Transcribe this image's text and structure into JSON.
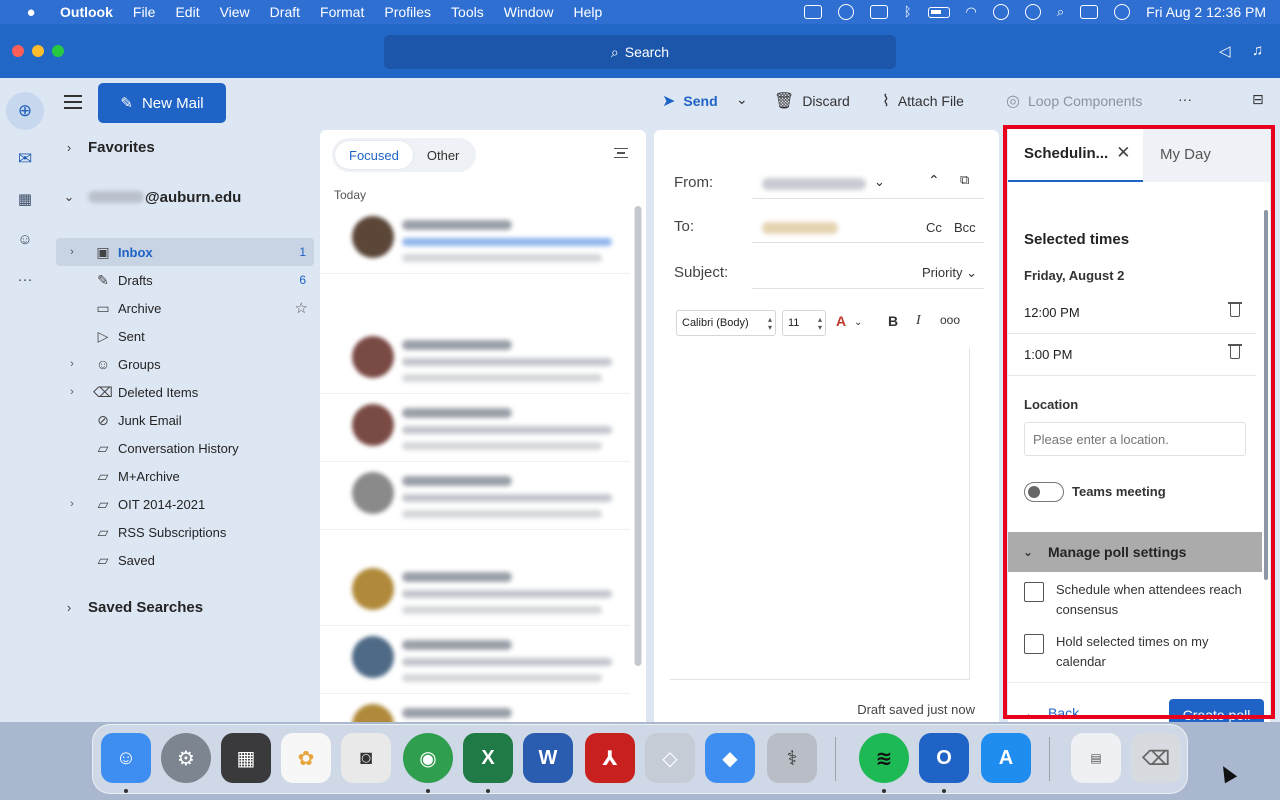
{
  "menubar": {
    "app_name": "Outlook",
    "items": [
      "File",
      "Edit",
      "View",
      "Draft",
      "Format",
      "Profiles",
      "Tools",
      "Window",
      "Help"
    ],
    "clock": "Fri Aug 2  12:36 PM"
  },
  "search": {
    "placeholder": "Search"
  },
  "toolbar": {
    "new_mail": "New Mail",
    "send": "Send",
    "discard": "Discard",
    "attach_file": "Attach File",
    "loop_components": "Loop Components",
    "more": "···"
  },
  "folders": {
    "favorites": "Favorites",
    "account_domain": "@auburn.edu",
    "saved_searches": "Saved Searches",
    "items": [
      {
        "label": "Inbox",
        "count": "1",
        "icon": "inbox-icon"
      },
      {
        "label": "Drafts",
        "count": "6",
        "icon": "pencil-icon"
      },
      {
        "label": "Archive",
        "count": "",
        "icon": "archive-icon"
      },
      {
        "label": "Sent",
        "count": "",
        "icon": "send-icon"
      },
      {
        "label": "Groups",
        "count": "",
        "icon": "people-icon"
      },
      {
        "label": "Deleted Items",
        "count": "",
        "icon": "trash-icon"
      },
      {
        "label": "Junk Email",
        "count": "",
        "icon": "junk-icon"
      },
      {
        "label": "Conversation History",
        "count": "",
        "icon": "folder-icon"
      },
      {
        "label": "M+Archive",
        "count": "",
        "icon": "folder-icon"
      },
      {
        "label": "OIT 2014-2021",
        "count": "",
        "icon": "folder-icon"
      },
      {
        "label": "RSS Subscriptions",
        "count": "",
        "icon": "folder-icon"
      },
      {
        "label": "Saved",
        "count": "",
        "icon": "folder-icon"
      }
    ]
  },
  "message_list": {
    "tab_focused": "Focused",
    "tab_other": "Other",
    "group_today": "Today"
  },
  "compose": {
    "from_label": "From:",
    "to_label": "To:",
    "cc": "Cc",
    "bcc": "Bcc",
    "subject_label": "Subject:",
    "priority": "Priority",
    "font_name": "Calibri (Body)",
    "font_size": "11",
    "draft_status": "Draft saved just now"
  },
  "scheduling": {
    "tab_active": "Schedulin...",
    "tab_other": "My Day",
    "heading": "Selected times",
    "date": "Friday, August 2",
    "times": [
      "12:00 PM",
      "1:00 PM"
    ],
    "location_label": "Location",
    "location_placeholder": "Please enter a location.",
    "teams_meeting": "Teams meeting",
    "manage_poll": "Manage poll settings",
    "option_consensus": "Schedule when attendees reach consensus",
    "option_hold": "Hold selected times on my calendar",
    "back": "Back",
    "create_poll": "Create poll"
  },
  "colors": {
    "accent": "#1f63c6",
    "titlebar": "#2266c6",
    "highlight_frame": "#e8001c"
  }
}
